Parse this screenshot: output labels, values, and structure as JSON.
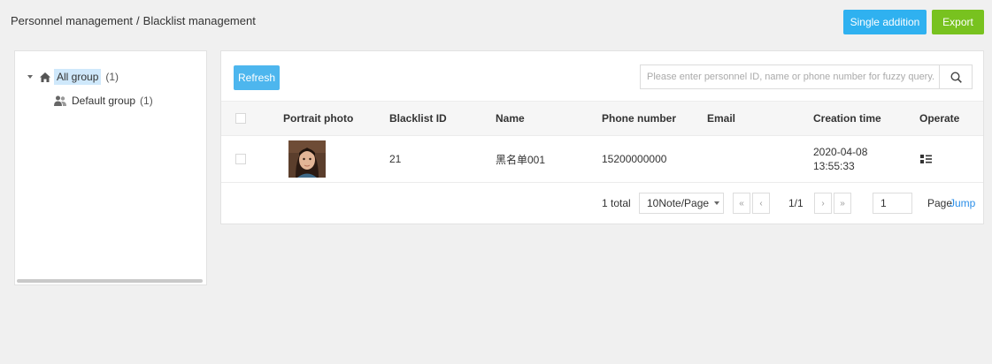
{
  "breadcrumb": {
    "parent": "Personnel management",
    "separator": "/",
    "current": "Blacklist management"
  },
  "header_buttons": {
    "add": "Single addition",
    "export": "Export"
  },
  "tree": {
    "root": {
      "label": "All group",
      "count": "(1)"
    },
    "children": [
      {
        "label": "Default group",
        "count": "(1)"
      }
    ]
  },
  "toolbar": {
    "refresh": "Refresh",
    "search_placeholder": "Please enter personnel ID, name or phone number for fuzzy query."
  },
  "table": {
    "columns": [
      "Portrait photo",
      "Blacklist ID",
      "Name",
      "Phone number",
      "Email",
      "Creation time",
      "Operate"
    ],
    "rows": [
      {
        "blacklist_id": "21",
        "name": "黑名单001",
        "phone": "15200000000",
        "email": "",
        "date": "2020-04-08",
        "time": "13:55:33"
      }
    ]
  },
  "pagination": {
    "total": "1 total",
    "page_size": "10Note/Page",
    "first": "«",
    "prev": "‹",
    "pages": "1/1",
    "next": "›",
    "last": "»",
    "page_value": "1",
    "page_label": "Page",
    "jump": "Jump"
  },
  "colors": {
    "add_button": "#2fb1f0",
    "export_button": "#78c21f",
    "refresh_button": "#4db6ee",
    "link": "#2a8ee8",
    "selected_node": "#cfe8fb"
  }
}
